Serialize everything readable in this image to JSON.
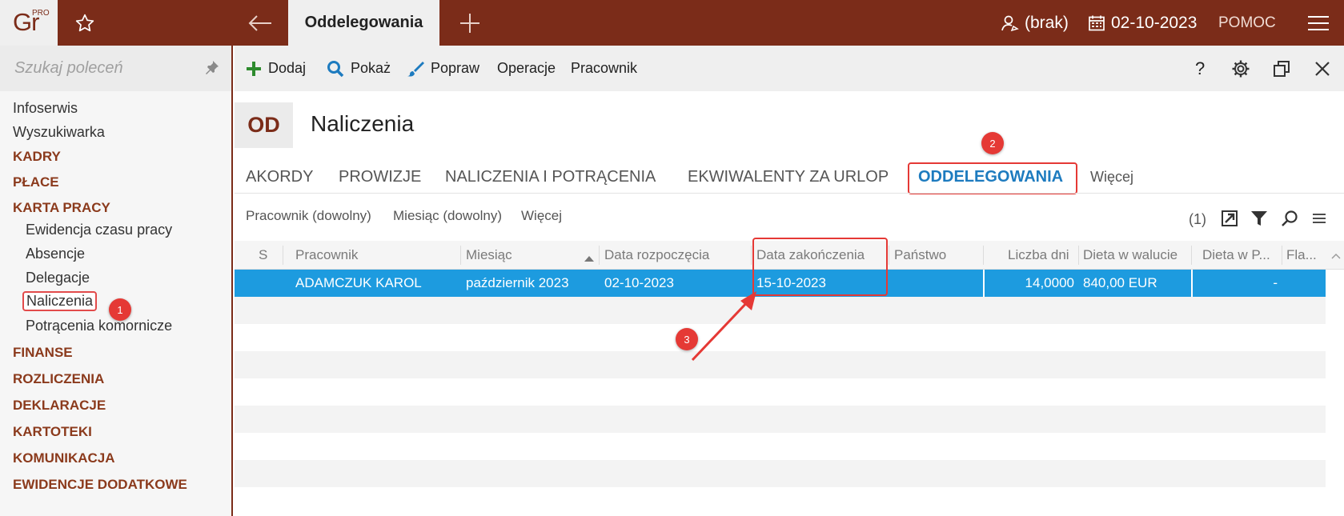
{
  "topbar": {
    "logo_text": "Gr",
    "logo_sup": "PRO",
    "active_tab": "Oddelegowania",
    "user": "(brak)",
    "date": "02-10-2023",
    "help": "POMOC"
  },
  "sidebar": {
    "search_placeholder": "Szukaj poleceń",
    "items": [
      {
        "label": "Infoserwis"
      },
      {
        "label": "Wyszukiwarka"
      },
      {
        "label": "KADRY"
      },
      {
        "label": "PŁACE"
      },
      {
        "label": "KARTA PRACY"
      },
      {
        "label": "Ewidencja czasu pracy"
      },
      {
        "label": "Absencje"
      },
      {
        "label": "Delegacje"
      },
      {
        "label": "Naliczenia"
      },
      {
        "label": "Potrącenia komornicze"
      },
      {
        "label": "FINANSE"
      },
      {
        "label": "ROZLICZENIA"
      },
      {
        "label": "DEKLARACJE"
      },
      {
        "label": "KARTOTEKI"
      },
      {
        "label": "KOMUNIKACJA"
      },
      {
        "label": "EWIDENCJE DODATKOWE"
      }
    ]
  },
  "toolbar": {
    "add": "Dodaj",
    "show": "Pokaż",
    "edit": "Popraw",
    "operations": "Operacje",
    "employee": "Pracownik",
    "help": "?"
  },
  "module": {
    "code": "OD",
    "title": "Naliczenia"
  },
  "tabs": [
    {
      "label": "AKORDY"
    },
    {
      "label": "PROWIZJE"
    },
    {
      "label": "NALICZENIA I POTRĄCENIA"
    },
    {
      "label": "EKWIWALENTY ZA URLOP"
    },
    {
      "label": "ODDELEGOWANIA"
    },
    {
      "label": "Więcej"
    }
  ],
  "filters": {
    "employee": "Pracownik (dowolny)",
    "month": "Miesiąc (dowolny)",
    "more": "Więcej",
    "count": "(1)"
  },
  "grid": {
    "columns": [
      "S",
      "Pracownik",
      "Miesiąc",
      "Data rozpoczęcia",
      "Data zakończenia",
      "Państwo",
      "Liczba dni",
      "Dieta w walucie",
      "Dieta w P...",
      "Fla..."
    ],
    "rows": [
      {
        "s": "",
        "employee": "ADAMCZUK KAROL",
        "month": "październik 2023",
        "start": "02-10-2023",
        "end": "15-10-2023",
        "country": "",
        "days": "14,0000",
        "diet_currency": "840,00 EUR",
        "diet_pln": "-",
        "flag": ""
      }
    ]
  },
  "annotations": {
    "badge1": "1",
    "badge2": "2",
    "badge3": "3"
  },
  "colors": {
    "brand": "#7b2c19",
    "selection": "#1d9bdf",
    "active_tab": "#1d7bbf",
    "highlight": "#e53935"
  }
}
